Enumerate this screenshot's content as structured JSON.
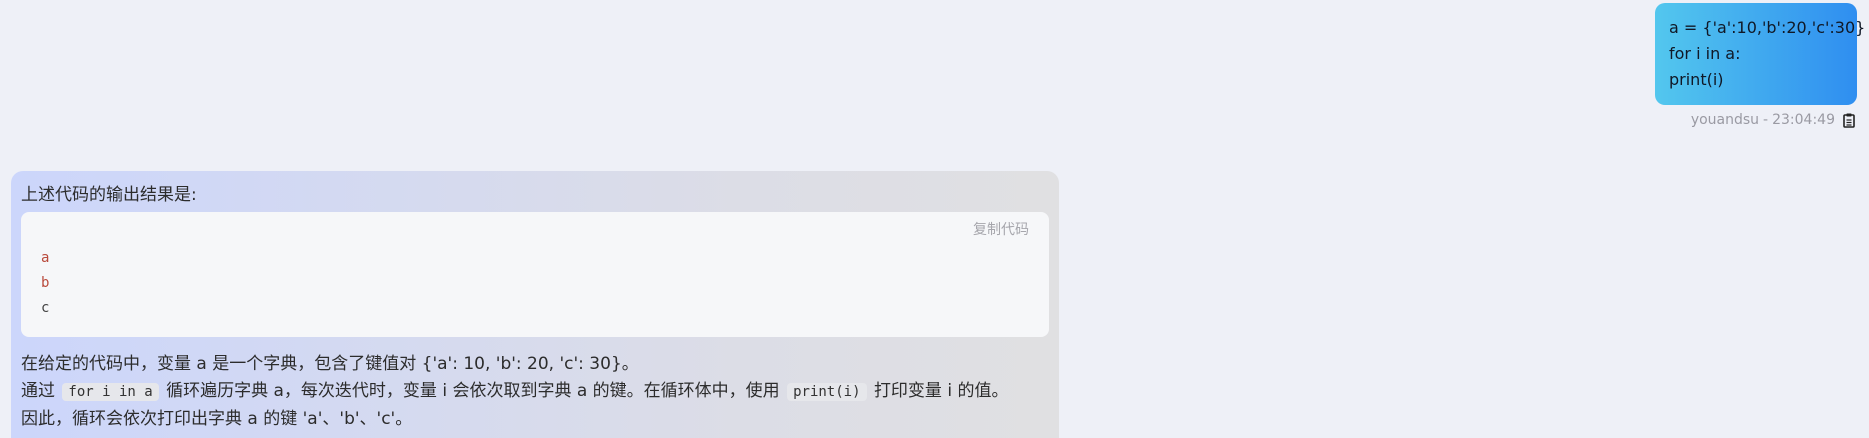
{
  "user_message": {
    "lines": [
      "a = {'a':10,'b':20,'c':30}",
      "for i in a:",
      "print(i)"
    ],
    "author": "youandsu",
    "separator": "-",
    "time": "23:04:49",
    "copy_icon": "clipboard-icon",
    "gradient": [
      "#53c7ee",
      "#2f8ef0"
    ]
  },
  "assistant_message": {
    "intro": "上述代码的输出结果是:",
    "code_block": {
      "copy_label": "复制代码",
      "lines": [
        "a",
        "b",
        "c"
      ]
    },
    "explanation": {
      "p1": "在给定的代码中，变量 a 是一个字典，包含了键值对 {'a': 10, 'b': 20, 'c': 30}。",
      "p2_before": "通过",
      "p2_code1": "for i in a",
      "p2_middle": "循环遍历字典 a，每次迭代时，变量 i 会依次取到字典 a 的键。在循环体中，使用",
      "p2_code2": "print(i)",
      "p2_after": "打印变量 i 的值。",
      "p3": "因此，循环会依次打印出字典 a 的键 'a'、'b'、'c'。"
    }
  }
}
